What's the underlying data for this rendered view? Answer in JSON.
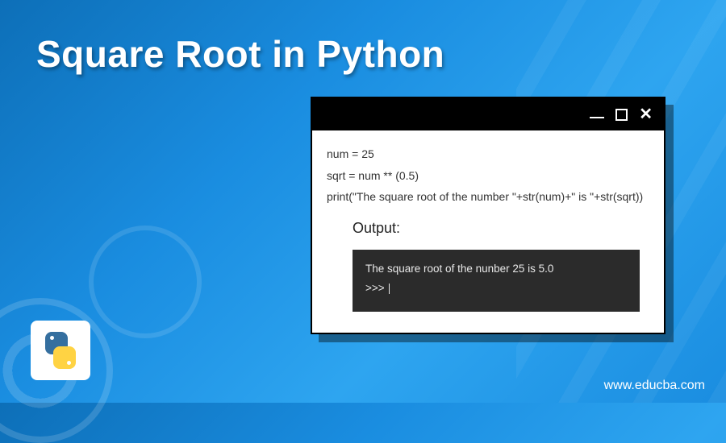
{
  "title": "Square Root in Python",
  "code": {
    "line1": "num = 25",
    "line2": "sqrt = num ** (0.5)",
    "line3": "print(\"The square root of the number \"+str(num)+\" is \"+str(sqrt))"
  },
  "output_label": "Output:",
  "output": {
    "line1": "The square root of the nunber 25 is 5.0",
    "prompt": ">>> "
  },
  "logo_name": "python-logo",
  "watermark": "www.educba.com",
  "icons": {
    "minimize": "minimize-icon",
    "maximize": "maximize-icon",
    "close": "close-icon"
  }
}
